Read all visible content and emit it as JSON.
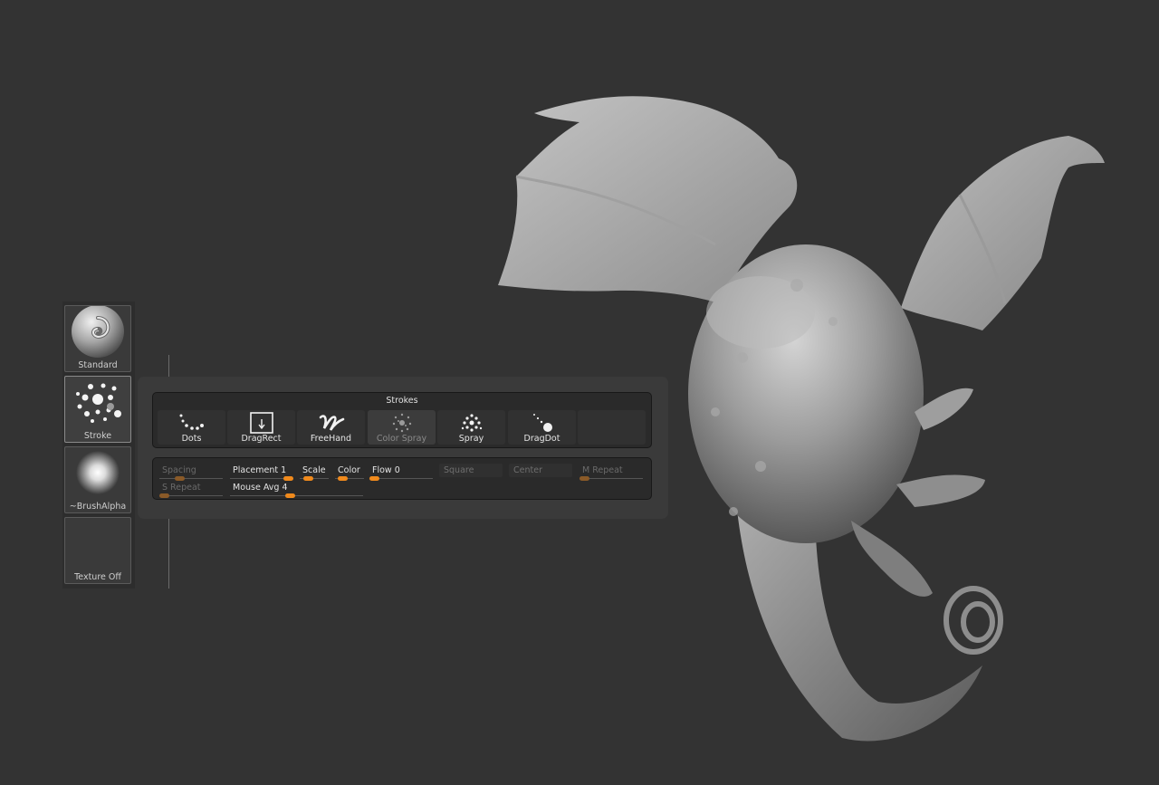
{
  "shelf": {
    "items": [
      {
        "label": "Standard",
        "icon": "standard-brush-icon"
      },
      {
        "label": "Stroke",
        "icon": "stroke-dots-icon"
      },
      {
        "label": "~BrushAlpha",
        "icon": "brush-alpha-icon"
      },
      {
        "label": "Texture Off",
        "icon": "texture-off-icon"
      }
    ]
  },
  "strokes": {
    "title": "Strokes",
    "types": [
      {
        "label": "Dots",
        "icon": "dots-icon"
      },
      {
        "label": "DragRect",
        "icon": "dragrect-icon"
      },
      {
        "label": "FreeHand",
        "icon": "freehand-icon"
      },
      {
        "label": "Color Spray",
        "icon": "color-spray-icon"
      },
      {
        "label": "Spray",
        "icon": "spray-icon"
      },
      {
        "label": "DragDot",
        "icon": "dragdot-icon"
      }
    ]
  },
  "settings": {
    "spacing": "Spacing",
    "placement": "Placement",
    "placement_value": "1",
    "scale": "Scale",
    "color": "Color",
    "flow": "Flow",
    "flow_value": "0",
    "square": "Square",
    "center": "Center",
    "m_repeat": "M Repeat",
    "s_repeat": "S Repeat",
    "mouse_avg": "Mouse Avg",
    "mouse_avg_value": "4"
  },
  "colors": {
    "accent": "#f08a1c",
    "background": "#333333",
    "panel": "#3a3a3a"
  }
}
